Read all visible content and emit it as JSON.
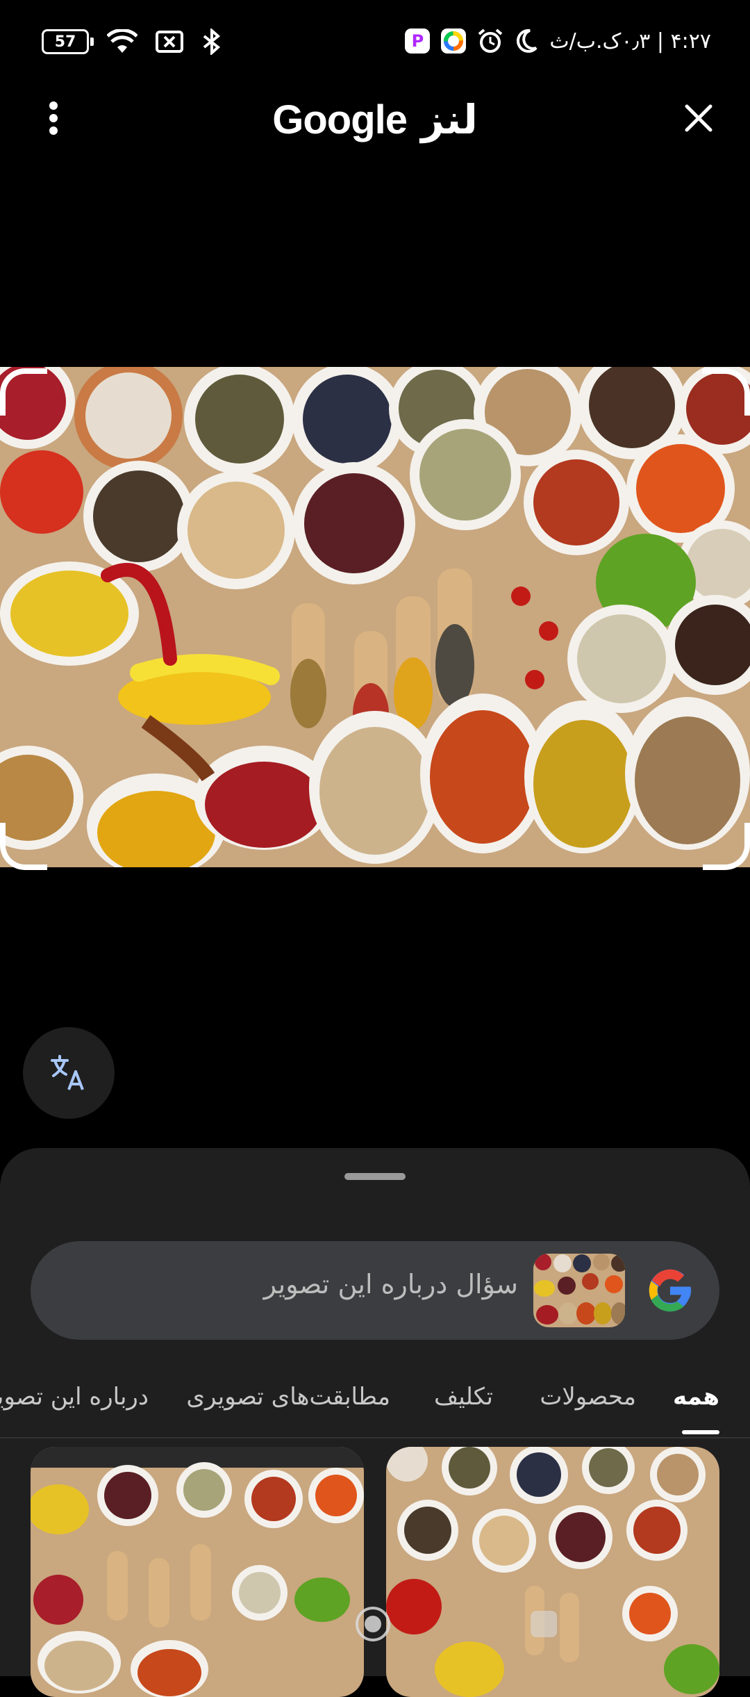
{
  "status_bar": {
    "time": "۴:۲۷ | ۰٫۳ک.ب/ث",
    "battery": "57",
    "icons": [
      "battery-icon",
      "wifi-icon",
      "sim-off-icon",
      "bluetooth-icon",
      "app-p-icon",
      "app-color-icon",
      "alarm-icon",
      "moon-icon"
    ]
  },
  "top_bar": {
    "title_brand": "Google",
    "title_suffix": "لنز",
    "menu_icon": "more-vert-icon",
    "close_icon": "close-icon"
  },
  "translate_button": {
    "icon": "translate-icon"
  },
  "search": {
    "placeholder": "سؤال درباره این تصویر",
    "logo_icon": "google-g-icon"
  },
  "tabs": [
    {
      "label": "همه",
      "active": true
    },
    {
      "label": "محصولات",
      "active": false
    },
    {
      "label": "تکلیف",
      "active": false
    },
    {
      "label": "مطابقت‌های تصویری",
      "active": false
    },
    {
      "label": "درباره این تصویر",
      "active": false
    }
  ],
  "colors": {
    "background": "#000000",
    "sheet": "#1f1f1f",
    "search_bar": "#3c3d40",
    "translate_icon": "#a8c7fa"
  }
}
